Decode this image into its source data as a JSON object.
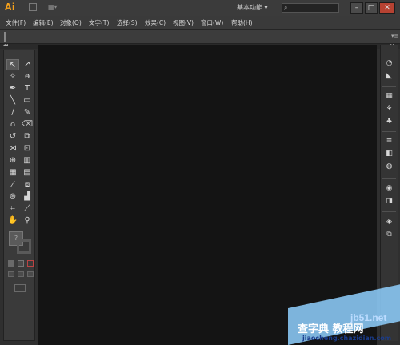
{
  "titlebar": {
    "logo": "Ai",
    "workspace": "基本功能",
    "workspace_arrow": "▾"
  },
  "menu": [
    "文件(F)",
    "编辑(E)",
    "对象(O)",
    "文字(T)",
    "选择(S)",
    "效果(C)",
    "视图(V)",
    "窗口(W)",
    "帮助(H)"
  ],
  "watermark": {
    "url": "jb51.net",
    "text": "查字典 教程网",
    "domain": "jiaocheng.chazidian.com"
  },
  "colors": {
    "logo": "#f7a21b",
    "close": "#b64232",
    "canvas": "#141414"
  }
}
